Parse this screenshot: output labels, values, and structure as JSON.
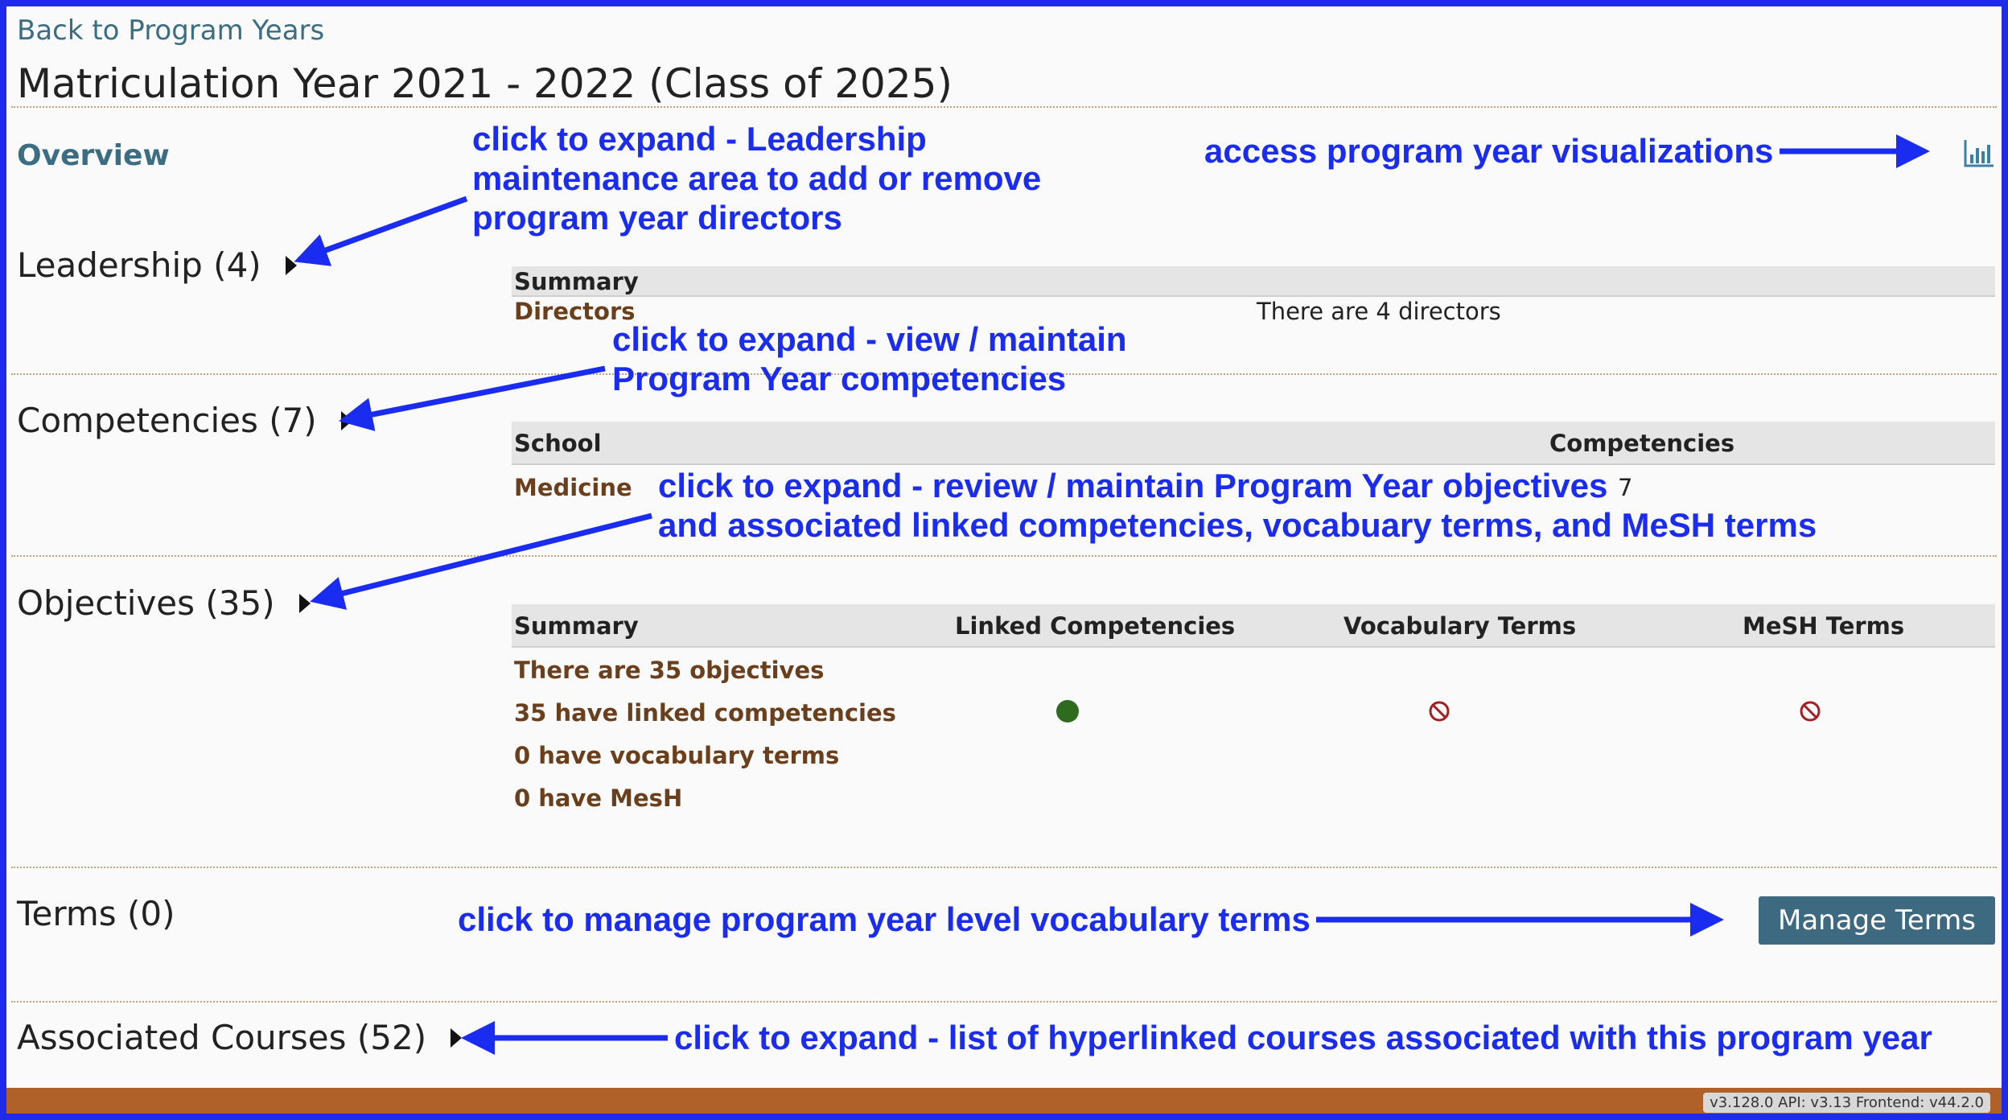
{
  "header": {
    "back_link": "Back to Program Years",
    "title": "Matriculation Year 2021 - 2022 (Class of 2025)",
    "overview": "Overview"
  },
  "sections": {
    "leadership": "Leadership (4)",
    "competencies": "Competencies (7)",
    "objectives": "Objectives (35)",
    "terms": "Terms (0)",
    "courses": "Associated Courses (52)"
  },
  "leadership_table": {
    "header": "Summary",
    "row_label": "Directors",
    "row_value": "There are 4 directors"
  },
  "competencies_table": {
    "col_school": "School",
    "col_competencies": "Competencies",
    "row_school": "Medicine",
    "row_count": "7"
  },
  "objectives_table": {
    "headers": [
      "Summary",
      "Linked Competencies",
      "Vocabulary Terms",
      "MeSH Terms"
    ],
    "rows": [
      "There are 35 objectives",
      "35 have linked competencies",
      "0 have vocabulary terms",
      "0 have MesH"
    ]
  },
  "buttons": {
    "manage_terms": "Manage Terms"
  },
  "annotations": {
    "leadership": [
      "click to expand - Leadership",
      "maintenance area to add or remove",
      "program year directors"
    ],
    "visualizations": "access program year visualizations",
    "competencies": [
      "click to expand - view / maintain",
      "Program Year competencies"
    ],
    "objectives": [
      "click to expand - review / maintain Program Year objectives",
      "and associated linked competencies, vocabuary terms, and MeSH terms"
    ],
    "terms": "click to manage program year level vocabulary terms",
    "courses": "click to expand - list of hyperlinked courses associated with this program year"
  },
  "footer": {
    "version": "v3.128.0 API: v3.13 Frontend: v44.2.0"
  },
  "colors": {
    "annotation": "#1a2cf0",
    "link": "#3b6d83",
    "brown_text": "#6b3f1b",
    "button": "#3d6a80",
    "footer": "#b0612a",
    "green_dot": "#2e6b1f",
    "no_icon": "#a61e22"
  },
  "icons": {
    "visualizations": "bar-chart-icon",
    "caret": "caret-right-icon",
    "yes": "filled-circle-icon",
    "no": "ban-icon"
  }
}
